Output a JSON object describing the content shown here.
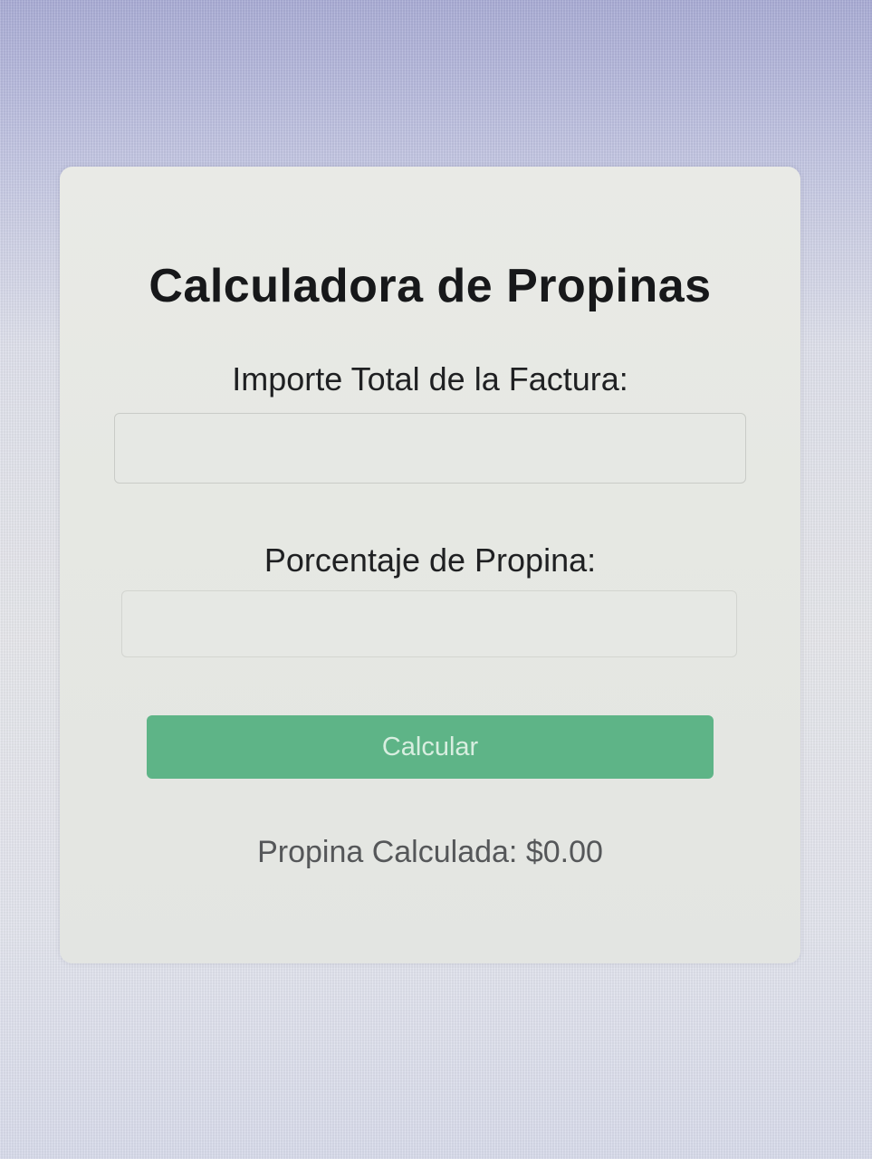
{
  "app": {
    "title": "Calculadora de Propinas"
  },
  "form": {
    "bill_label": "Importe Total de la Factura:",
    "bill_value": "",
    "tip_label": "Porcentaje de Propina:",
    "tip_value": "",
    "calculate_label": "Calcular"
  },
  "result": {
    "label": "Propina Calculada:",
    "value": "$0.00"
  },
  "colors": {
    "button": "#5eb487",
    "card": "#e6e8e4"
  }
}
